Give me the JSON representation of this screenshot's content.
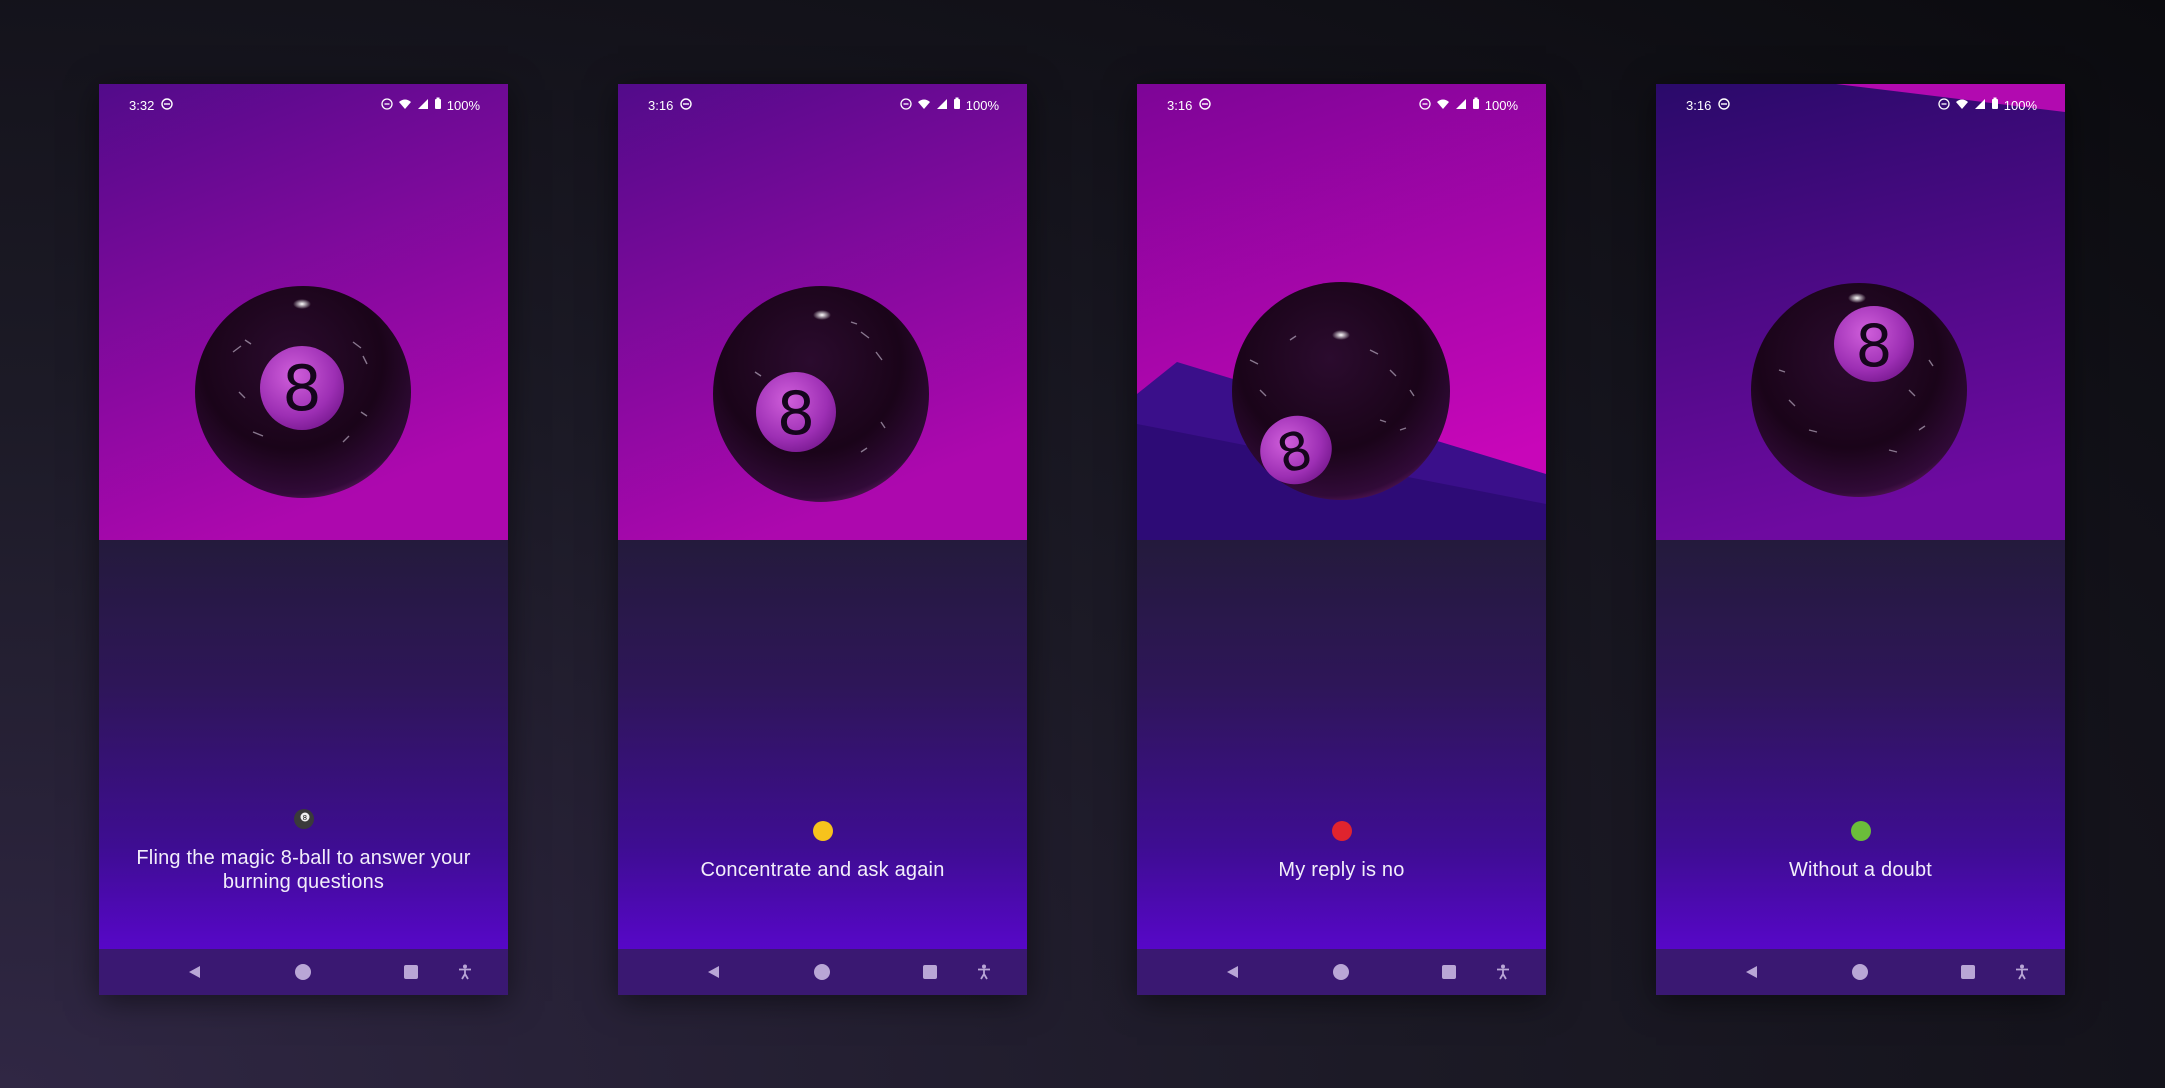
{
  "screens": [
    {
      "time": "3:32",
      "battery": "100%",
      "answer": "Fling the magic 8-ball to answer your burning questions",
      "indicator": "8-ball-icon",
      "ball_number": "8"
    },
    {
      "time": "3:16",
      "battery": "100%",
      "answer": "Concentrate and ask again",
      "indicator": "yellow-circle-icon",
      "indicator_color": "#f7c21c",
      "ball_number": "8"
    },
    {
      "time": "3:16",
      "battery": "100%",
      "answer": "My reply is no",
      "indicator": "red-circle-icon",
      "indicator_color": "#e0242e",
      "ball_number": "8"
    },
    {
      "time": "3:16",
      "battery": "100%",
      "answer": "Without a doubt",
      "indicator": "green-circle-icon",
      "indicator_color": "#6bbd3a",
      "ball_number": "8"
    }
  ],
  "colors": {
    "scene_top": "#5c0a8f",
    "scene_bottom": "#a809b0",
    "accent": "#c43fe0"
  },
  "nav_icons": [
    "back-icon",
    "home-icon",
    "recents-icon",
    "accessibility-icon"
  ]
}
